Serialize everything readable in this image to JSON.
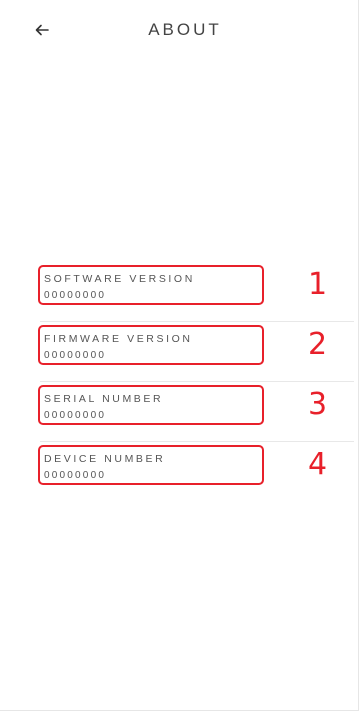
{
  "header": {
    "title": "ABOUT",
    "back_icon": "arrow-left-icon"
  },
  "colors": {
    "accent": "#e8202a",
    "text": "#555555",
    "divider": "#e8e8e8"
  },
  "info_rows": [
    {
      "label": "SOFTWARE VERSION",
      "value": "00000000",
      "number": "1"
    },
    {
      "label": "FIRMWARE VERSION",
      "value": "00000000",
      "number": "2"
    },
    {
      "label": "SERIAL NUMBER",
      "value": "00000000",
      "number": "3"
    },
    {
      "label": "DEVICE NUMBER",
      "value": "00000000",
      "number": "4"
    }
  ]
}
